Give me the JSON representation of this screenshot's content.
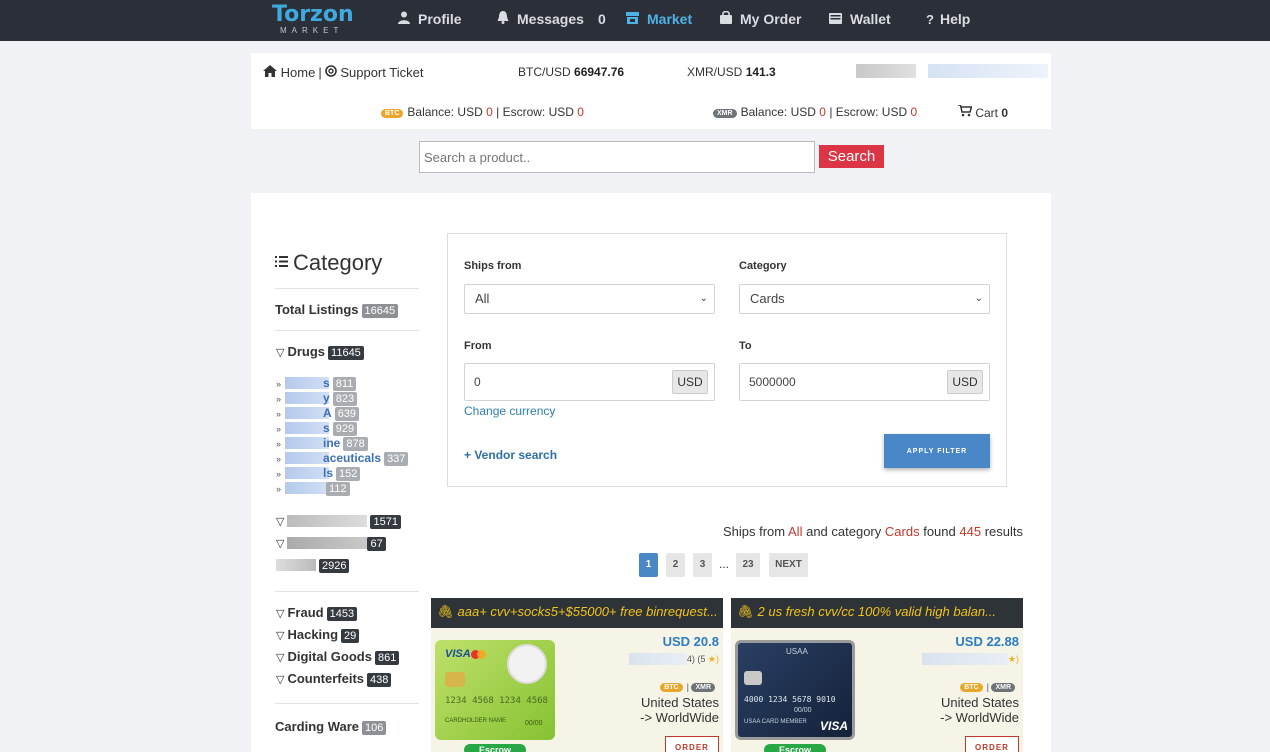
{
  "nav": {
    "logo_main": "Torzon",
    "logo_sub": "MARKET",
    "items": [
      {
        "label": "Profile",
        "icon": "user-icon"
      },
      {
        "label": "Messages",
        "icon": "bell-icon",
        "count": "0"
      },
      {
        "label": "Market",
        "icon": "store-icon",
        "active": true
      },
      {
        "label": "My Order",
        "icon": "bag-icon"
      },
      {
        "label": "Wallet",
        "icon": "wallet-icon"
      },
      {
        "label": "Help",
        "icon": "question-icon"
      }
    ]
  },
  "header": {
    "home": "Home",
    "separator": "|",
    "support": "Support Ticket",
    "btc_label": "BTC/USD",
    "btc_rate": "66947.76",
    "xmr_label": "XMR/USD",
    "xmr_rate": "141.3",
    "btc_badge": "BTC",
    "xmr_badge": "XMR",
    "balance_label": "Balance: USD",
    "escrow_label": "| Escrow: USD",
    "btc_balance": "0",
    "btc_escrow": "0",
    "xmr_balance": "0",
    "xmr_escrow": "0",
    "cart_label": "Cart",
    "cart_count": "0"
  },
  "search": {
    "placeholder": "Search a product..",
    "button": "Search"
  },
  "sidebar": {
    "title": "Category",
    "total_label": "Total Listings",
    "total_count": "16645",
    "drugs_label": "Drugs",
    "drugs_count": "11645",
    "drug_subs": [
      {
        "suffix": "s",
        "count": "811"
      },
      {
        "suffix": "y",
        "count": "823"
      },
      {
        "suffix": "A",
        "count": "639"
      },
      {
        "suffix": "s",
        "count": "929"
      },
      {
        "suffix": "ine",
        "count": "878"
      },
      {
        "suffix": "aceuticals",
        "count": "337"
      },
      {
        "suffix": "ls",
        "count": "152"
      },
      {
        "suffix": "",
        "count": "112"
      }
    ],
    "blurred_cats": [
      {
        "count": "1571"
      },
      {
        "count": "67"
      },
      {
        "count": "2926"
      }
    ],
    "cats": [
      {
        "label": "Fraud",
        "count": "1453"
      },
      {
        "label": "Hacking",
        "count": "29"
      },
      {
        "label": "Digital Goods",
        "count": "861"
      },
      {
        "label": "Counterfeits",
        "count": "438"
      }
    ],
    "carding_label": "Carding Ware",
    "carding_count": "106"
  },
  "filter": {
    "ships_from_label": "Ships from",
    "ships_from_value": "All",
    "category_label": "Category",
    "category_value": "Cards",
    "from_label": "From",
    "from_value": "0",
    "to_label": "To",
    "to_value": "5000000",
    "unit": "USD",
    "change_currency": "Change currency",
    "vendor_search": "+ Vendor search",
    "apply": "APPLY FILTER"
  },
  "results": {
    "prefix": "Ships from",
    "ships": "All",
    "mid": "and category",
    "cat": "Cards",
    "found": "found",
    "count": "445",
    "suffix": "results"
  },
  "pagination": {
    "pages": [
      "1",
      "2",
      "3"
    ],
    "dots": "...",
    "last": "23",
    "next": "NEXT"
  },
  "products": [
    {
      "title": "aaa+ cvv+socks5+$55000+ free binrequest...",
      "price": "USD 20.8",
      "rating": "4) (5",
      "star": "★)",
      "coin_a": "BTC",
      "coin_sep": "|",
      "coin_b": "XMR",
      "country": "United States",
      "ships_to": "-> WorldWide",
      "order": "ORDER",
      "escrow": "Escrow",
      "card_brand": "VISA",
      "card_number": "1234 4568 1234 4568",
      "card_name": "CARDHOLDER NAME",
      "card_exp": "00/00"
    },
    {
      "title": "2 us fresh cvv/cc 100% valid high balan...",
      "price": "USD 22.88",
      "rating": "",
      "star": "★)",
      "coin_a": "BTC",
      "coin_sep": "|",
      "coin_b": "XMR",
      "country": "United States",
      "ships_to": "-> WorldWide",
      "order": "ORDER",
      "escrow": "Escrow",
      "card_brand": "VISA",
      "card_number": "4000 1234 5678 9010",
      "card_name": "USAA CARD MEMBER",
      "card_exp": "00/00",
      "card_bank": "USAA"
    }
  ]
}
